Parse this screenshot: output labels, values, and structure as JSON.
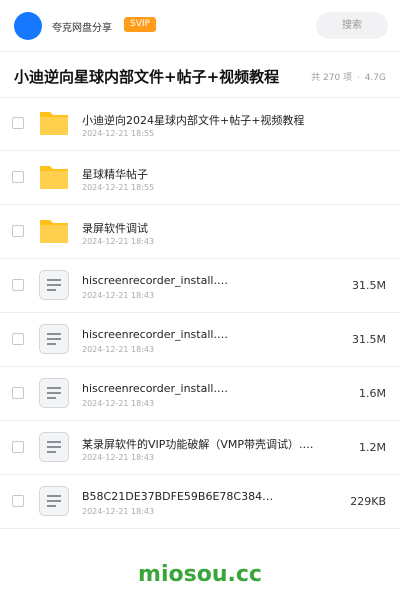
{
  "header": {
    "app_name": "夸克网盘分享",
    "badge": "SVIP",
    "search_placeholder": "搜索"
  },
  "folder": {
    "title": "小迪逆向星球内部文件+帖子+视频教程",
    "count": "共 270 项",
    "separator": "·",
    "total_size": "4.7G"
  },
  "files": [
    {
      "name": "小迪逆向2024星球内部文件+帖子+视频教程",
      "date": "2024-12-21 18:55",
      "size": "",
      "type": "folder"
    },
    {
      "name": "星球精华帖子",
      "date": "2024-12-21 18:55",
      "size": "",
      "type": "folder"
    },
    {
      "name": "录屏软件调试",
      "date": "2024-12-21 18:43",
      "size": "",
      "type": "folder"
    },
    {
      "name": "hiscreenrecorder_install.…",
      "date": "2024-12-21 18:43",
      "size": "31.5M",
      "type": "file"
    },
    {
      "name": "hiscreenrecorder_install.…",
      "date": "2024-12-21 18:43",
      "size": "31.5M",
      "type": "file"
    },
    {
      "name": "hiscreenrecorder_install.…",
      "date": "2024-12-21 18:43",
      "size": "1.6M",
      "type": "file"
    },
    {
      "name": "某录屏软件的VIP功能破解（VMP带壳调试）.…",
      "date": "2024-12-21 18:43",
      "size": "1.2M",
      "type": "file"
    },
    {
      "name": "B58C21DE37BDFE59B6E78C384…",
      "date": "2024-12-21 18:43",
      "size": "229KB",
      "type": "file"
    }
  ],
  "watermark": "miosou.cc",
  "colors": {
    "accent": "#1677ff",
    "svip": "#ff9c1a",
    "folder": "#ffc21a",
    "watermark": "#3aa53a"
  }
}
